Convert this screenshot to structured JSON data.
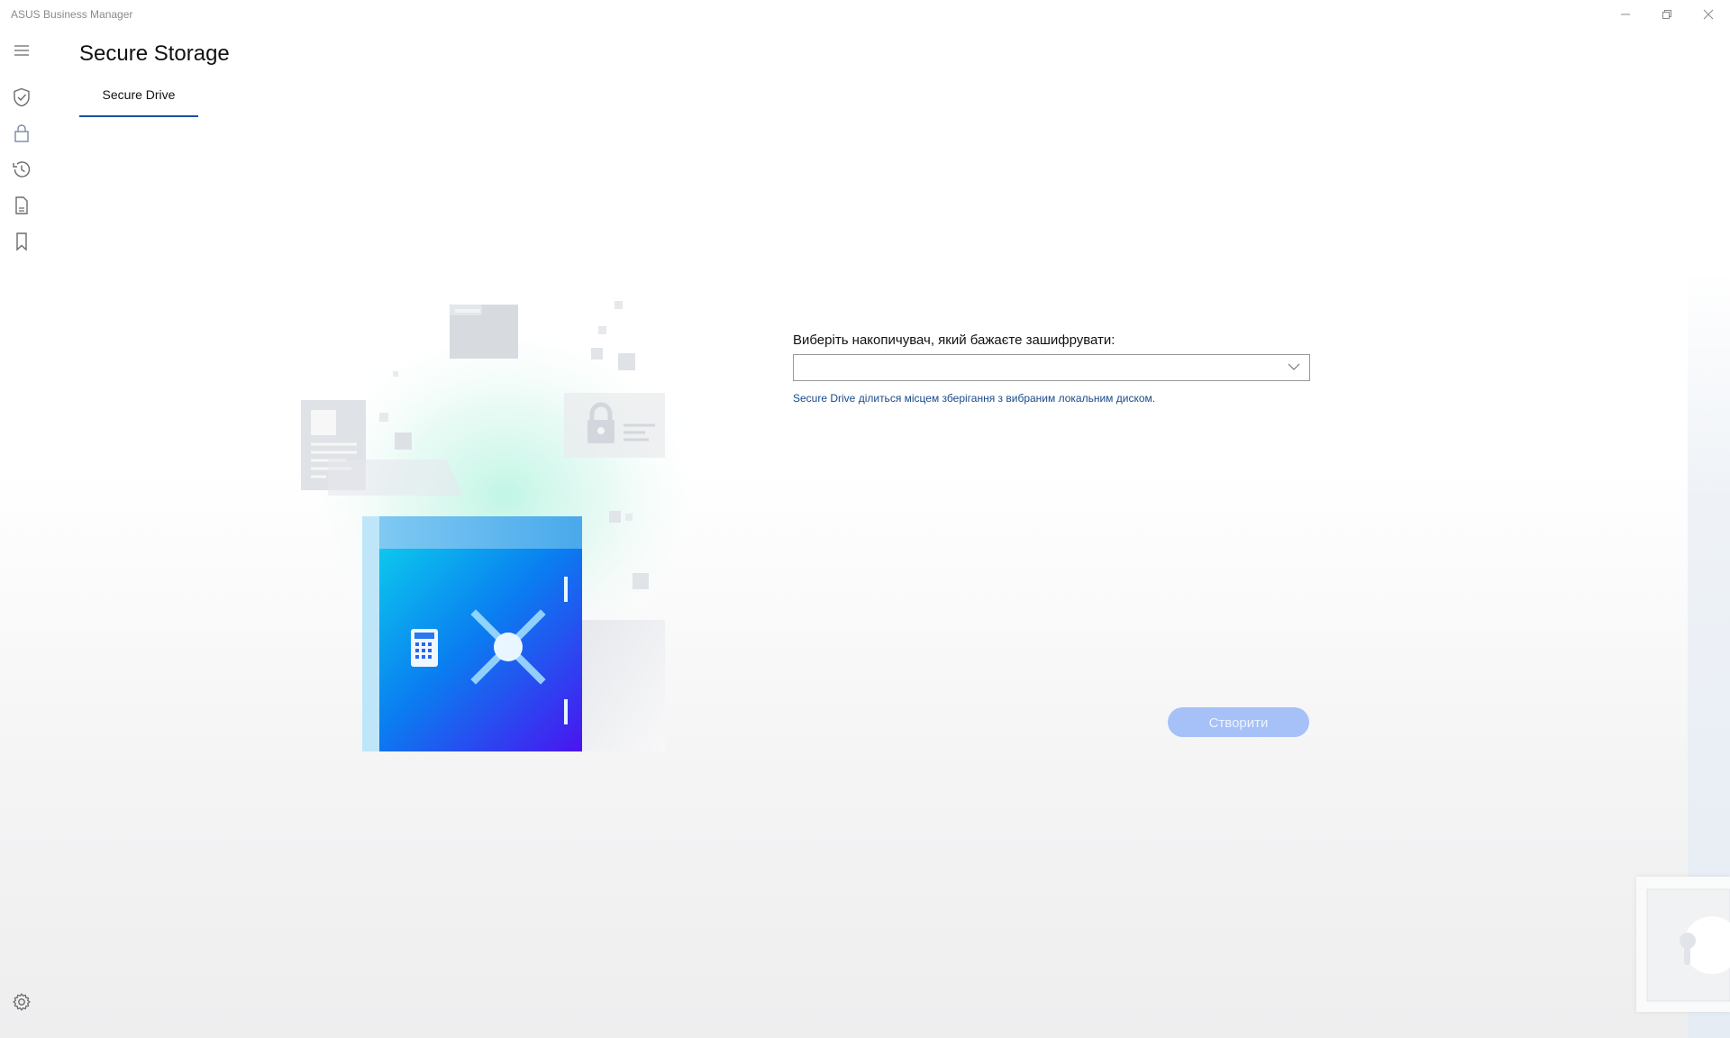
{
  "window": {
    "title": "ASUS Business Manager",
    "controls": {
      "minimize": "minimize-icon",
      "restore": "restore-icon",
      "close": "close-icon"
    }
  },
  "sidebar": {
    "items": [
      {
        "icon": "menu-icon"
      },
      {
        "icon": "shield-check-icon"
      },
      {
        "icon": "lock-icon"
      },
      {
        "icon": "history-icon"
      },
      {
        "icon": "document-icon"
      },
      {
        "icon": "bookmark-icon"
      }
    ],
    "footer_icon": "gear-icon"
  },
  "header": {
    "title": "Secure Storage",
    "tabs": [
      {
        "label": "Secure Drive",
        "active": true
      }
    ]
  },
  "form": {
    "drive_label": "Виберіть накопичувач, який бажаєте зашифрувати:",
    "drive_value": "",
    "hint": "Secure Drive ділиться місцем зберігання з вибраним локальним диском.",
    "create_label": "Створити",
    "create_enabled": false
  },
  "colors": {
    "accent": "#1a4fa3",
    "button_disabled": "#a6c1f7",
    "hint_text": "#1a4a8a"
  }
}
